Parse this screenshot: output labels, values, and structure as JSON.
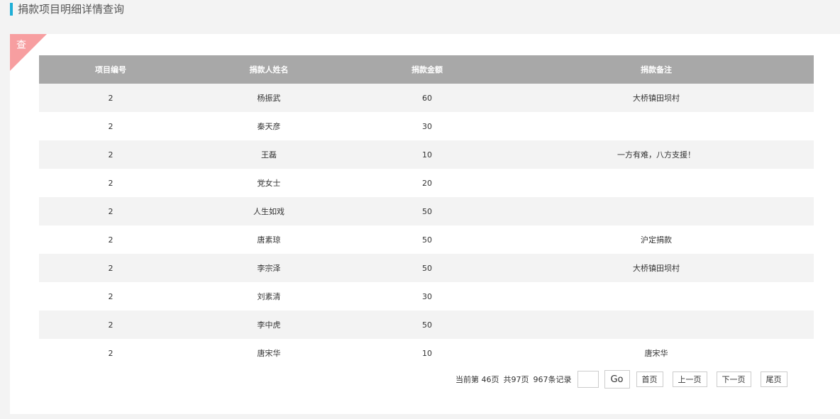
{
  "header": {
    "title": "捐款项目明细详情查询"
  },
  "panel": {
    "corner_label": "查"
  },
  "table": {
    "columns": [
      "项目编号",
      "捐款人姓名",
      "捐款金额",
      "捐款备注"
    ],
    "rows": [
      [
        "2",
        "杨振武",
        "60",
        "大桥镇田坝村"
      ],
      [
        "2",
        "秦天彦",
        "30",
        ""
      ],
      [
        "2",
        "王磊",
        "10",
        "一方有难，八方支援！"
      ],
      [
        "2",
        "党女士",
        "20",
        ""
      ],
      [
        "2",
        "人生如戏",
        "50",
        ""
      ],
      [
        "2",
        "唐素琼",
        "50",
        "沪定捐款"
      ],
      [
        "2",
        "李宗泽",
        "50",
        "大桥镇田坝村"
      ],
      [
        "2",
        "刘素清",
        "30",
        ""
      ],
      [
        "2",
        "李中虎",
        "50",
        ""
      ],
      [
        "2",
        "唐宋华",
        "10",
        "唐宋华"
      ]
    ]
  },
  "pager": {
    "current_page": "当前第  46页",
    "total_pages": "共97页",
    "total_records": "967条记录",
    "page_input_value": "",
    "go_label": "Go",
    "first_label": "首页",
    "prev_label": "上一页",
    "next_label": "下一页",
    "last_label": "尾页"
  },
  "colors": {
    "accent": "#1eaed6",
    "corner": "#f79ea0",
    "table_header": "#a8a8a8",
    "row_stripe": "#f3f3f3"
  }
}
